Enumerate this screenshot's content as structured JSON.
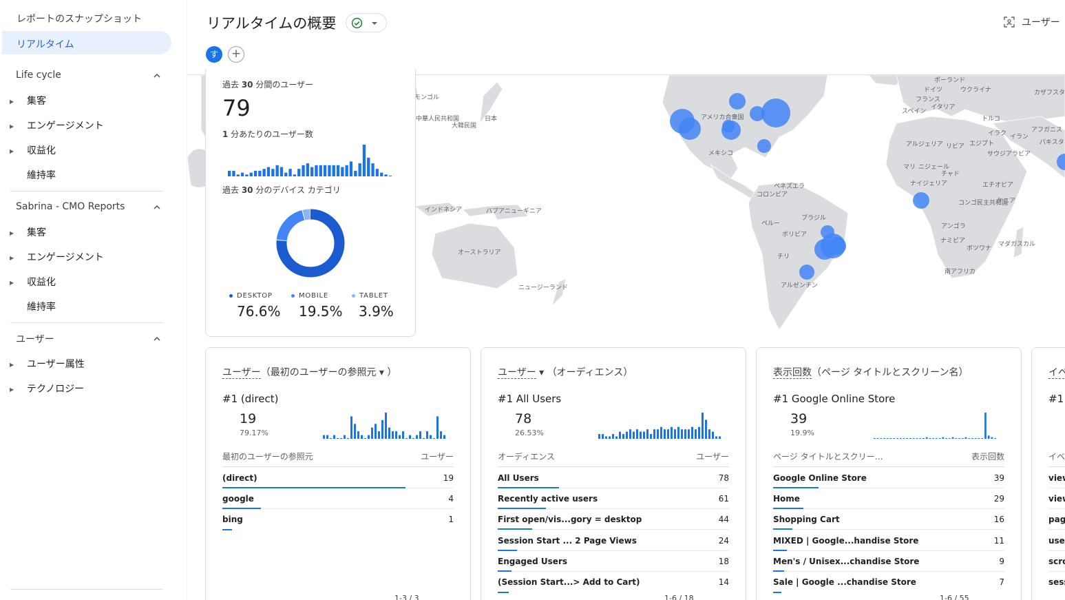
{
  "sidebar": {
    "snapshot": "レポートのスナップショット",
    "realtime": "リアルタイム",
    "sections": [
      {
        "title": "Life cycle",
        "items": [
          "集客",
          "エンゲージメント",
          "収益化"
        ],
        "plain": "維持率"
      },
      {
        "title": "Sabrina - CMO Reports",
        "items": [
          "集客",
          "エンゲージメント",
          "収益化"
        ],
        "plain": "維持率"
      },
      {
        "title": "ユーザー",
        "items": [
          "ユーザー属性",
          "テクノロジー"
        ]
      }
    ]
  },
  "header": {
    "title": "リアルタイムの概要",
    "avatar": "す",
    "add": "+",
    "user_snapshot": "ユーザー"
  },
  "overview": {
    "users_30min_label_pre": "過去 ",
    "users_30min_label_num": "30",
    "users_30min_label_post": " 分間のユーザー",
    "users_30min": "79",
    "per_minute_label_num": "1",
    "per_minute_label_post": " 分あたりのユーザー数",
    "device_label_pre": "過去 ",
    "device_label_num": "30",
    "device_label_post": " 分のデバイス カテゴリ",
    "per_minute_values": [
      3,
      3,
      1,
      2,
      1,
      2,
      3,
      3,
      4,
      5,
      4,
      6,
      5,
      2,
      4,
      1,
      4,
      6,
      7,
      5,
      6,
      6,
      6,
      6,
      6,
      6,
      5,
      6,
      8,
      3,
      7,
      17,
      10,
      7,
      4,
      2,
      1,
      0
    ],
    "devices": [
      {
        "label": "DESKTOP",
        "value": "76.6%",
        "share": 76.6,
        "color": "#1a5cd0"
      },
      {
        "label": "MOBILE",
        "value": "19.5%",
        "share": 19.5,
        "color": "#4285f4"
      },
      {
        "label": "TABLET",
        "value": "3.9%",
        "share": 3.9,
        "color": "#8ab4f8"
      }
    ]
  },
  "map_labels": [
    "ポーランド",
    "ドイツ",
    "ウクライナ",
    "フランス",
    "イタリア",
    "スペイン",
    "トルコ",
    "カザフスタ",
    "イラク",
    "イラン",
    "アフガニス",
    "パキスタ",
    "アルジェリア",
    "リビア",
    "エジプト",
    "サウジアラビア",
    "マリ",
    "ニジェール",
    "チャド",
    "ナイジェリア",
    "エチオピア",
    "コンゴ民主共和国",
    "ケニア",
    "アンゴラ",
    "ナミビア",
    "ボツワナ",
    "マダガスカル",
    "南アフリカ",
    "アメリカ合衆国",
    "メキシコ",
    "ベネズエラ",
    "コロンビア",
    "ブラジル",
    "ペルー",
    "ボリビア",
    "チリ",
    "アルゼンチン",
    "モンゴル",
    "中華人民共和国",
    "日本",
    "大韓民国",
    "インドネシア",
    "パプアニューギニア",
    "オーストラリア",
    "ニュージーランド"
  ],
  "cards": [
    {
      "title_u": "ユーザー",
      "title_rest": "（最初のユーザーの参照元 ▾ ）",
      "rank": "#1  (direct)",
      "value": "19",
      "pct": "79.17%",
      "spark": [
        1,
        1,
        0,
        1,
        0,
        0,
        1,
        0,
        6,
        4,
        2,
        1,
        0,
        1,
        3,
        4,
        2,
        5,
        7,
        3,
        2,
        2,
        1,
        2,
        0,
        1,
        0,
        1,
        2,
        0,
        2,
        1,
        0,
        6,
        2,
        1
      ],
      "col_left": "最初のユーザーの参照元",
      "col_right": "ユーザー",
      "rows": [
        {
          "name": "(direct)",
          "num": "19",
          "share": 1.0
        },
        {
          "name": "google",
          "num": "4",
          "share": 0.21
        },
        {
          "name": "bing",
          "num": "1",
          "share": 0.05
        }
      ],
      "pager": "1-3 / 3"
    },
    {
      "title_u": "ユーザー",
      "title_rest": " ▾  （オーディエンス）",
      "rank": "#1  All Users",
      "value": "78",
      "pct": "26.53%",
      "spark": [
        2,
        2,
        1,
        1,
        2,
        1,
        3,
        2,
        3,
        4,
        3,
        4,
        3,
        3,
        4,
        2,
        4,
        4,
        5,
        4,
        4,
        5,
        4,
        5,
        4,
        4,
        4,
        5,
        4,
        5,
        11,
        8,
        4,
        3,
        1,
        1
      ],
      "col_left": "オーディエンス",
      "col_right": "ユーザー",
      "rows": [
        {
          "name": "All Users",
          "num": "78",
          "share": 0.4
        },
        {
          "name": "Recently active users",
          "num": "61",
          "share": 0.32
        },
        {
          "name": "First open/vis...gory = desktop",
          "num": "44",
          "share": 0.23
        },
        {
          "name": "Session Start ... 2 Page Views",
          "num": "24",
          "share": 0.13
        },
        {
          "name": "Engaged Users",
          "num": "18",
          "share": 0.09
        },
        {
          "name": "(Session Start...> Add to Cart)",
          "num": "14",
          "share": 0.07
        }
      ],
      "pager": "1-6 / 18"
    },
    {
      "title_u": "表示回数",
      "title_rest": "（ページ タイトルとスクリーン名）",
      "rank": "#1  Google Online Store",
      "value": "39",
      "pct": "19.9%",
      "spark": [
        0,
        0,
        0,
        0,
        0,
        0,
        0,
        0,
        0,
        0,
        0,
        0,
        0,
        0,
        0,
        0,
        1,
        0,
        0,
        0,
        0,
        1,
        0,
        0,
        1,
        0,
        0,
        0,
        1,
        0,
        0,
        0,
        0,
        0,
        16,
        2,
        1,
        0
      ],
      "col_left": "ページ タイトルとスクリー…",
      "col_right": "表示回数",
      "rows": [
        {
          "name": "Google Online Store",
          "num": "39",
          "share": 0.2
        },
        {
          "name": "Home",
          "num": "29",
          "share": 0.15
        },
        {
          "name": "Shopping Cart",
          "num": "16",
          "share": 0.08
        },
        {
          "name": "MIXED | Google...handise Store",
          "num": "11",
          "share": 0.06
        },
        {
          "name": "Men's / Unisex...chandise Store",
          "num": "9",
          "share": 0.05
        },
        {
          "name": "Sale | Google ...chandise Store",
          "num": "7",
          "share": 0.04
        }
      ],
      "pager": "1-6 / 55"
    },
    {
      "title_u": "イベ",
      "rank": "#1",
      "col_left": "イベ",
      "rows": [
        "view",
        "view",
        "page",
        "user",
        "scro",
        "sess"
      ]
    }
  ]
}
